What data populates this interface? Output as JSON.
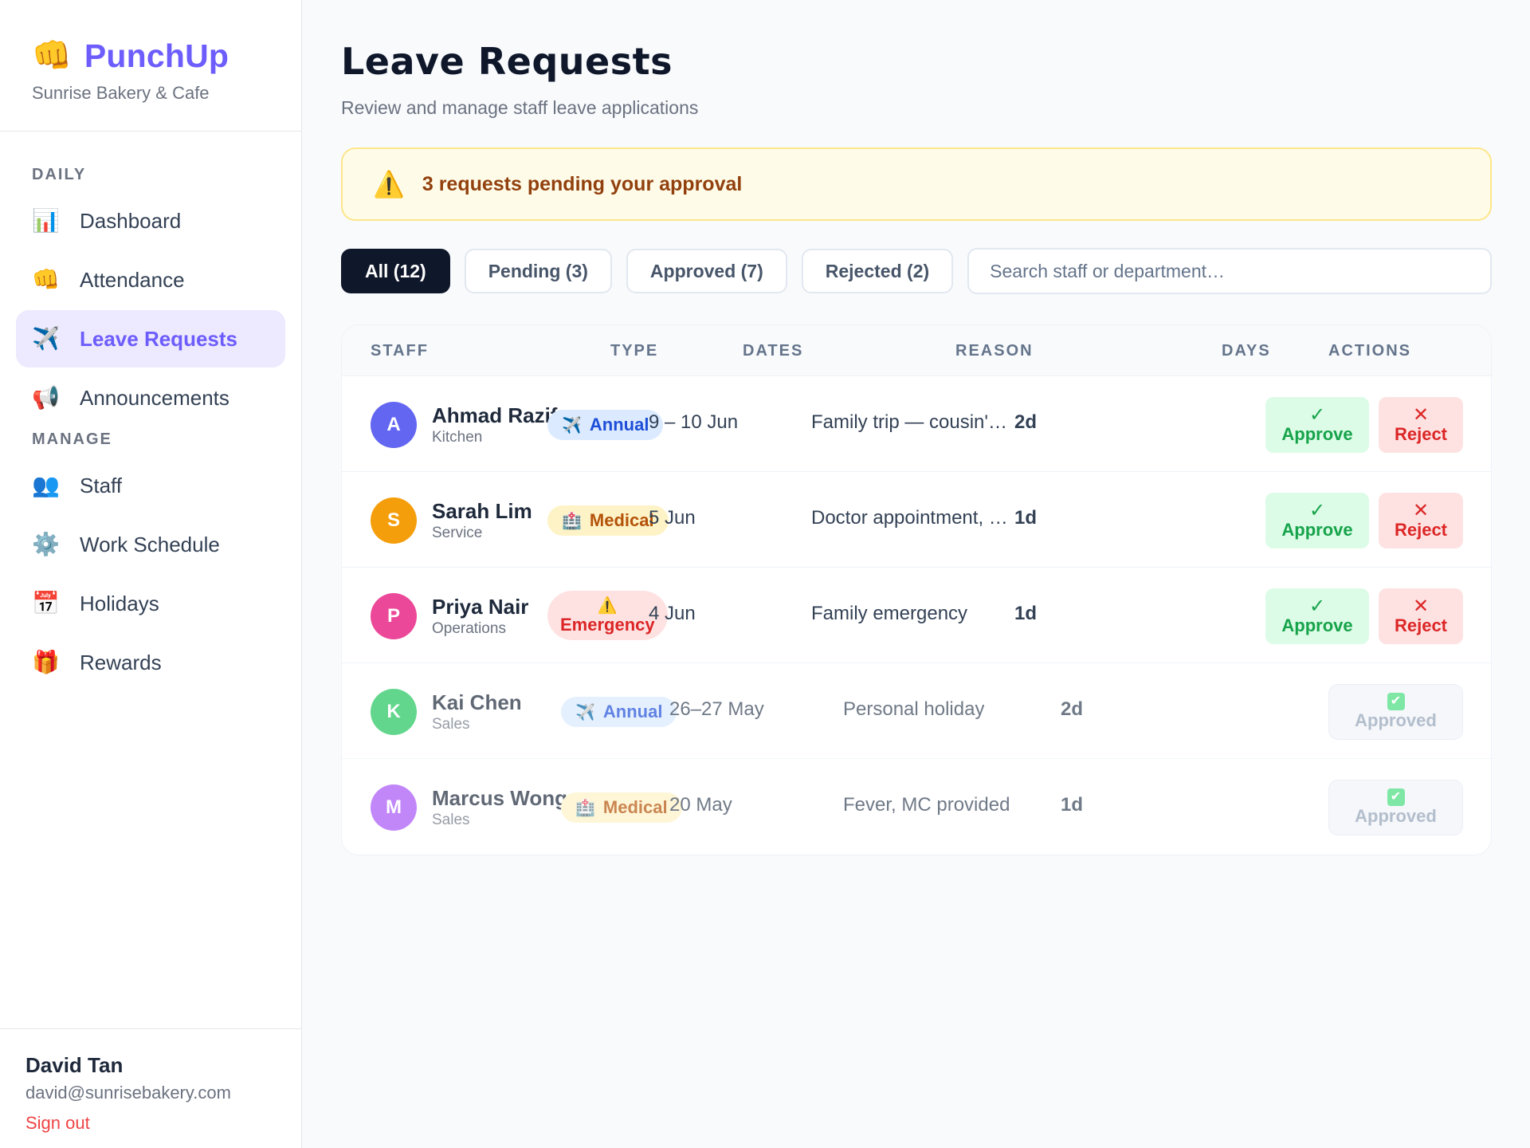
{
  "brand": {
    "logo_icon": "👊",
    "name": "PunchUp",
    "subtitle": "Sunrise Bakery & Cafe"
  },
  "sidebar": {
    "sections": [
      {
        "title": "DAILY",
        "items": [
          {
            "label": "Dashboard",
            "icon": "📊",
            "icon_name": "bar-chart-icon"
          },
          {
            "label": "Attendance",
            "icon": "👊",
            "icon_name": "fist-icon"
          },
          {
            "label": "Leave Requests",
            "icon": "✈️",
            "icon_name": "airplane-icon",
            "active": true
          },
          {
            "label": "Announcements",
            "icon": "📢",
            "icon_name": "megaphone-icon"
          }
        ]
      },
      {
        "title": "MANAGE",
        "items": [
          {
            "label": "Staff",
            "icon": "👥",
            "icon_name": "people-icon"
          },
          {
            "label": "Work Schedule",
            "icon": "⚙️",
            "icon_name": "gear-icon"
          },
          {
            "label": "Holidays",
            "icon": "📅",
            "icon_name": "calendar-icon"
          },
          {
            "label": "Rewards",
            "icon": "🎁",
            "icon_name": "gift-icon"
          }
        ]
      }
    ]
  },
  "user": {
    "name": "David Tan",
    "email": "david@sunrisebakery.com",
    "signout_label": "Sign out"
  },
  "page": {
    "title": "Leave Requests",
    "subtitle": "Review and manage staff leave applications"
  },
  "alert": {
    "icon": "⚠️",
    "text": "3 requests pending your approval"
  },
  "filters": {
    "tabs": [
      {
        "label": "All (12)",
        "active": true
      },
      {
        "label": "Pending (3)"
      },
      {
        "label": "Approved (7)"
      },
      {
        "label": "Rejected (2)"
      }
    ],
    "search_placeholder": "Search staff or department…"
  },
  "table": {
    "columns": [
      "STAFF",
      "TYPE",
      "DATES",
      "REASON",
      "DAYS",
      "ACTIONS"
    ],
    "approve_label": "Approve",
    "approve_icon": "✓",
    "reject_label": "Reject",
    "reject_icon": "✕",
    "approved_status_label": "Approved",
    "approved_status_icon": "✔",
    "rows": [
      {
        "initial": "A",
        "avatar_color": "#6366f1",
        "name": "Ahmad Razif",
        "dept": "Kitchen",
        "type": "Annual",
        "type_icon": "✈️",
        "type_class": "annual",
        "dates": "9 – 10 Jun",
        "reason": "Family trip — cousin's wed…",
        "days": "2d",
        "status": "pending"
      },
      {
        "initial": "S",
        "avatar_color": "#f59e0b",
        "name": "Sarah Lim",
        "dept": "Service",
        "type": "Medical",
        "type_icon": "🏥",
        "type_class": "medical",
        "dates": "5 Jun",
        "reason": "Doctor appointment, MC at…",
        "days": "1d",
        "status": "pending"
      },
      {
        "initial": "P",
        "avatar_color": "#ec4899",
        "name": "Priya Nair",
        "dept": "Operations",
        "type": "Emergency",
        "type_icon": "⚠️",
        "type_class": "emergency",
        "dates": "4 Jun",
        "reason": "Family emergency",
        "days": "1d",
        "status": "pending"
      },
      {
        "initial": "K",
        "avatar_color": "#22c55e",
        "name": "Kai Chen",
        "dept": "Sales",
        "type": "Annual",
        "type_icon": "✈️",
        "type_class": "annual",
        "dates": "26–27 May",
        "reason": "Personal holiday",
        "days": "2d",
        "status": "approved"
      },
      {
        "initial": "M",
        "avatar_color": "#a855f7",
        "name": "Marcus Wong",
        "dept": "Sales",
        "type": "Medical",
        "type_icon": "🏥",
        "type_class": "medical",
        "dates": "20 May",
        "reason": "Fever, MC provided",
        "days": "1d",
        "status": "approved"
      }
    ]
  }
}
